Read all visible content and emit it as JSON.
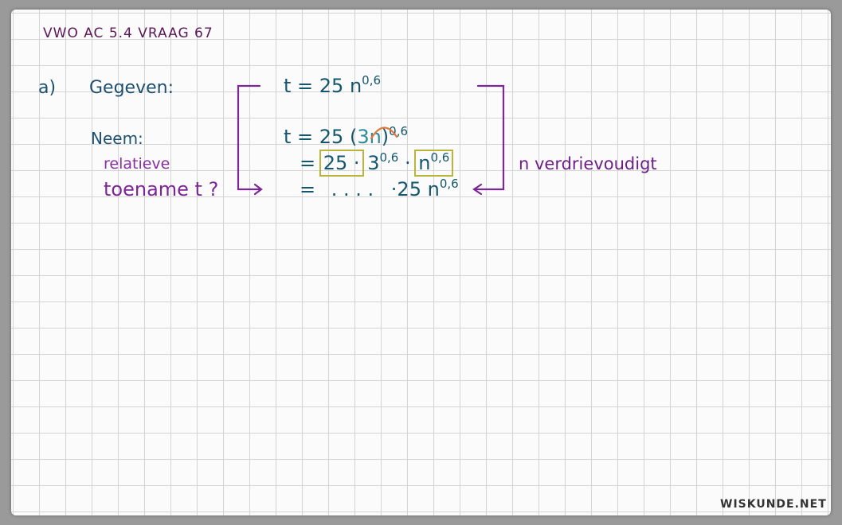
{
  "title": "VWO AC 5.4 VRAAG 67",
  "part_label": "a)",
  "given_label": "Gegeven:",
  "take_label": "Neem:",
  "question_line1": "relatieve",
  "question_line2": "toename t ?",
  "eq1": {
    "lhs": "t = 25 n",
    "exp": "0,6"
  },
  "eq2": {
    "lhs": "t = 25 (",
    "inner": "3n",
    "close": ")",
    "exp": "0,6"
  },
  "eq3": {
    "eq": "=",
    "box1": "25 ·",
    "base": "3",
    "exp1": "0,6",
    "dot": "·",
    "box2_base": "n",
    "box2_exp": "0,6"
  },
  "eq4": {
    "eq": "=",
    "dots": ". . . .",
    "tail": "·25 n",
    "exp": "0,6"
  },
  "note": "n verdrievoudigt",
  "footer": "WISKUNDE.NET",
  "colors": {
    "purple": "#6e1f87",
    "teal": "#15566e",
    "highlight_box": "#bbb43a",
    "arc": "#e07a3c"
  }
}
